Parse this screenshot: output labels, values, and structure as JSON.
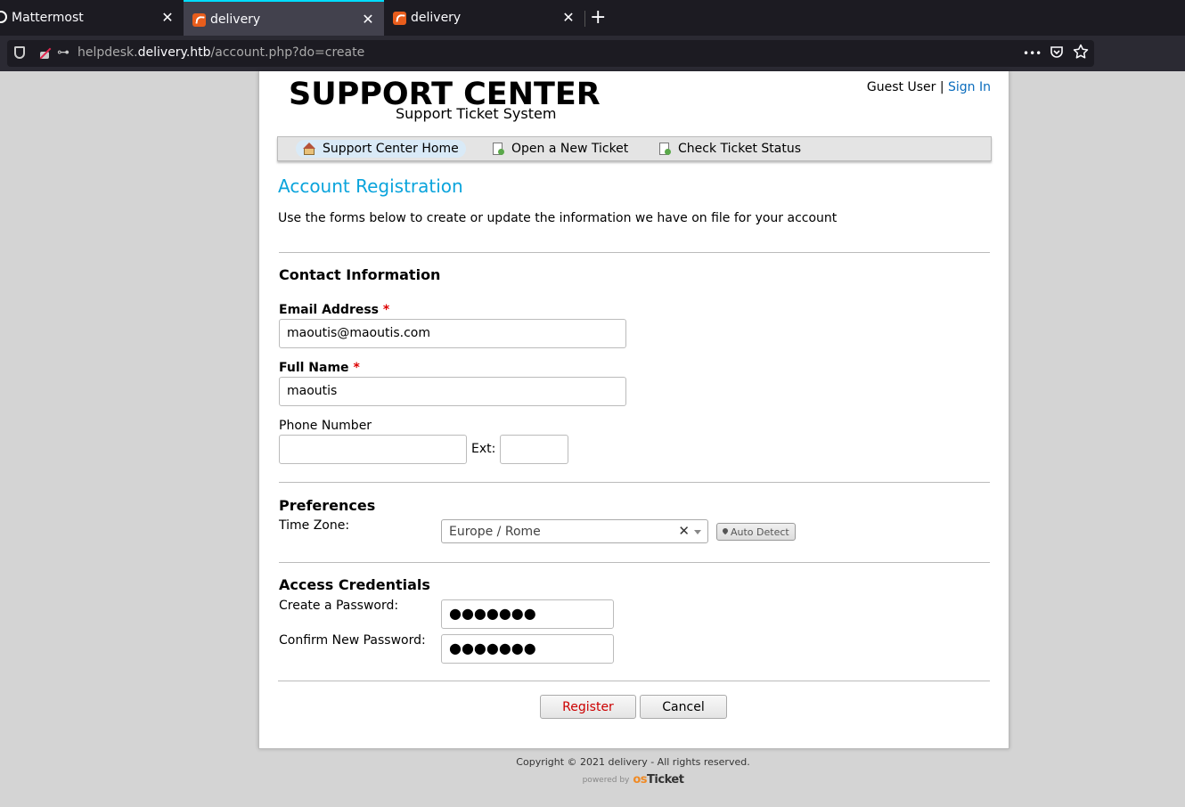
{
  "browser": {
    "tabs": [
      {
        "label": "Mattermost"
      },
      {
        "label": "delivery"
      },
      {
        "label": "delivery"
      }
    ],
    "close_glyph": "✕",
    "new_tab_glyph": "+",
    "url": {
      "prefix": "helpdesk.",
      "domain": "delivery.htb",
      "path": "/account.php?do=create"
    },
    "menu_glyph": "•••",
    "key_glyph": "⊶"
  },
  "header": {
    "logo_title": "SUPPORT CENTER",
    "logo_subtitle": "Support Ticket System",
    "guest_label": "Guest User",
    "separator": "|",
    "sign_in": "Sign In"
  },
  "nav": {
    "items": [
      {
        "label": "Support Center Home",
        "icon": "home-icon"
      },
      {
        "label": "Open a New Ticket",
        "icon": "new-ticket-icon"
      },
      {
        "label": "Check Ticket Status",
        "icon": "ticket-status-icon"
      }
    ]
  },
  "main": {
    "title": "Account Registration",
    "intro": "Use the forms below to create or update the information we have on file for your account",
    "contact": {
      "heading": "Contact Information",
      "email_label": "Email Address",
      "email_value": "maoutis@maoutis.com",
      "name_label": "Full Name",
      "name_value": "maoutis",
      "required_mark": "*",
      "phone_label": "Phone Number",
      "phone_value": "",
      "ext_label": "Ext:",
      "ext_value": ""
    },
    "preferences": {
      "heading": "Preferences",
      "timezone_label": "Time Zone:",
      "timezone_value": "Europe / Rome",
      "clear_glyph": "✕",
      "auto_detect": "Auto Detect"
    },
    "credentials": {
      "heading": "Access Credentials",
      "password_label": "Create a Password:",
      "password_value": "●●●●●●●",
      "confirm_label": "Confirm New Password:",
      "confirm_value": "●●●●●●●"
    },
    "buttons": {
      "register": "Register",
      "cancel": "Cancel"
    }
  },
  "footer": {
    "copyright": "Copyright © 2021 delivery - All rights reserved.",
    "powered_by": "powered by",
    "brand_os": "os",
    "brand_ticket": "Ticket"
  },
  "colors": {
    "title_blue": "#0aa4dc",
    "link_blue": "#0a6cbd",
    "required_red": "#dd0000",
    "register_red": "#cc0000"
  }
}
